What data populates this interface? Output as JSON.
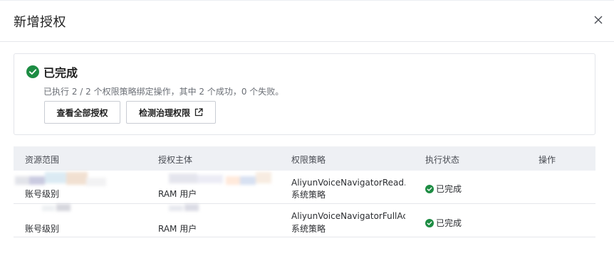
{
  "dialog": {
    "title": "新增授权"
  },
  "result": {
    "status": "已完成",
    "summary": "已执行 2 / 2 个权限策略绑定操作，其中 2 个成功，0 个失败。",
    "buttons": {
      "view_all": "查看全部授权",
      "check_governance": "检测治理权限"
    }
  },
  "table": {
    "columns": [
      "资源范围",
      "授权主体",
      "权限策略",
      "执行状态",
      "操作"
    ],
    "rows": [
      {
        "scope": "账号级别",
        "principal": "RAM 用户",
        "policy_name": "AliyunVoiceNavigatorRead...",
        "policy_type": "系统策略",
        "status": "已完成"
      },
      {
        "scope": "账号级别",
        "principal": "RAM 用户",
        "policy_name": "AliyunVoiceNavigatorFullAc...",
        "policy_type": "系统策略",
        "status": "已完成"
      }
    ]
  },
  "colors": {
    "success": "#1d8c43",
    "header_bg": "#eef0f4"
  },
  "icons": {
    "close": "close-icon",
    "success": "check-circle-icon",
    "external": "external-link-icon"
  }
}
